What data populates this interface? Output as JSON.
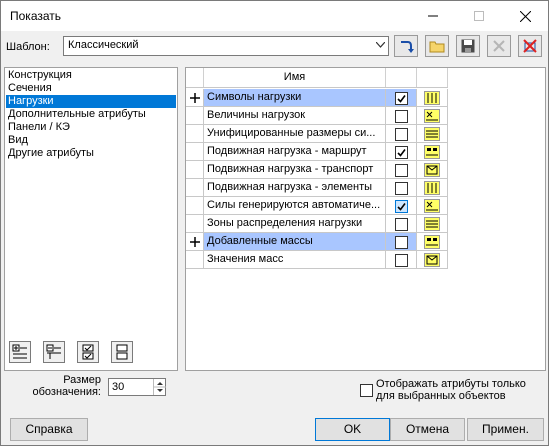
{
  "window": {
    "title": "Показать"
  },
  "template": {
    "label": "Шаблон:",
    "value": "Классический"
  },
  "categories": [
    {
      "label": "Конструкция",
      "selected": false
    },
    {
      "label": "Сечения",
      "selected": false
    },
    {
      "label": "Нагрузки",
      "selected": true
    },
    {
      "label": "Дополнительные атрибуты",
      "selected": false
    },
    {
      "label": "Панели / КЭ",
      "selected": false
    },
    {
      "label": "Вид",
      "selected": false
    },
    {
      "label": "Другие атрибуты",
      "selected": false
    }
  ],
  "grid": {
    "header": "Имя",
    "rows": [
      {
        "name": "Символы нагрузки",
        "checked": true,
        "group": true
      },
      {
        "name": "Величины нагрузок",
        "checked": false,
        "group": false
      },
      {
        "name": "Унифицированные размеры си...",
        "checked": false,
        "group": false
      },
      {
        "name": "Подвижная нагрузка - маршрут",
        "checked": true,
        "group": false
      },
      {
        "name": "Подвижная нагрузка - транспорт",
        "checked": false,
        "group": false
      },
      {
        "name": "Подвижная нагрузка - элементы",
        "checked": false,
        "group": false
      },
      {
        "name": "Силы генерируются автоматиче...",
        "checked": true,
        "group": false,
        "focused": true
      },
      {
        "name": "Зоны распределения нагрузки",
        "checked": false,
        "group": false
      },
      {
        "name": "Добавленные массы",
        "checked": false,
        "group": true
      },
      {
        "name": "Значения масс",
        "checked": false,
        "group": false
      }
    ]
  },
  "size": {
    "label_line1": "Размер",
    "label_line2": "обозначения:",
    "value": "30"
  },
  "only_selected": {
    "label_line1": "Отображать атрибуты только",
    "label_line2": "для выбранных объектов",
    "checked": false
  },
  "buttons": {
    "help": "Справка",
    "ok": "OK",
    "cancel": "Отмена",
    "apply": "Примен."
  },
  "colors": {
    "selection": "#0078d7",
    "group_row": "#a9c6ff",
    "swatch": "#ffff66"
  }
}
